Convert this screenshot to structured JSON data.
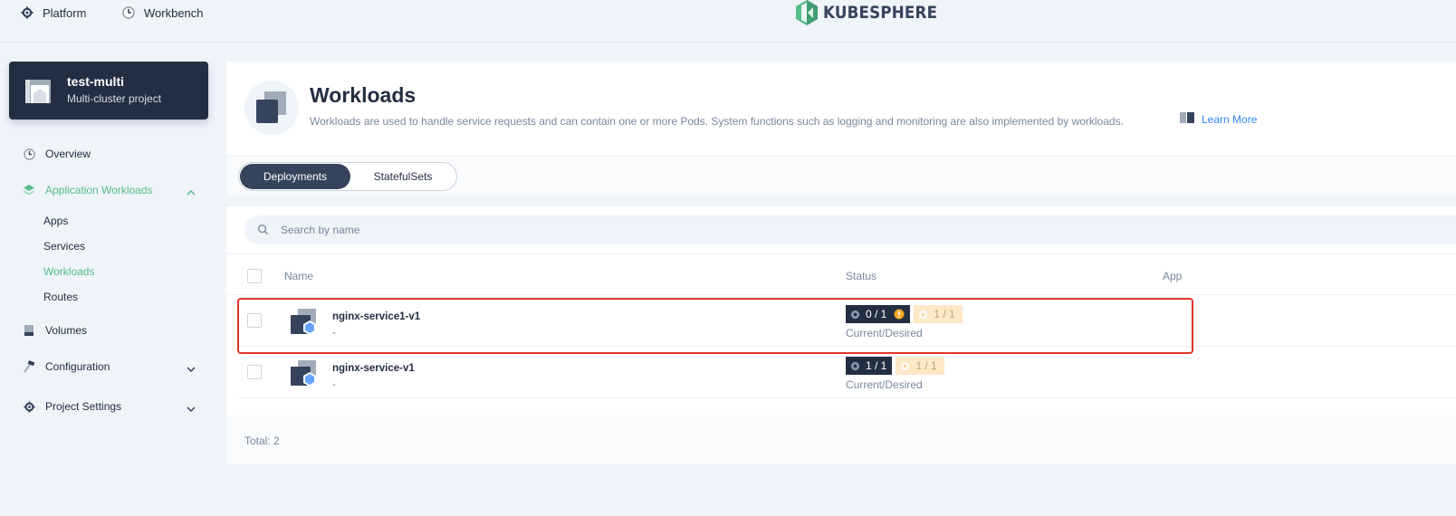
{
  "topbar": {
    "platform_label": "Platform",
    "workbench_label": "Workbench",
    "logo_text": "KUBESPHERE"
  },
  "project": {
    "name": "test-multi",
    "type": "Multi-cluster project"
  },
  "sidebar": {
    "overview": "Overview",
    "app_workloads": "Application Workloads",
    "sub": [
      "Apps",
      "Services",
      "Workloads",
      "Routes"
    ],
    "volumes": "Volumes",
    "configuration": "Configuration",
    "project_settings": "Project Settings"
  },
  "page": {
    "title": "Workloads",
    "description": "Workloads are used to handle service requests and can contain one or more Pods. System functions such as logging and monitoring are also implemented by workloads.",
    "learn_more": "Learn More"
  },
  "tabs": [
    "Deployments",
    "StatefulSets"
  ],
  "search": {
    "placeholder": "Search by name"
  },
  "table": {
    "columns": [
      "Name",
      "Status",
      "App"
    ],
    "rows": [
      {
        "name": "nginx-service1-v1",
        "desc": "-",
        "current": "0 / 1",
        "desired": "1 / 1",
        "status_label": "Current/Desired",
        "warning": true
      },
      {
        "name": "nginx-service-v1",
        "desc": "-",
        "current": "1 / 1",
        "desired": "1 / 1",
        "status_label": "Current/Desired",
        "warning": false
      }
    ],
    "total": "Total: 2"
  },
  "colors": {
    "accent_green": "#55bc8a",
    "dark": "#242e42",
    "highlight_red": "#e0352b",
    "link_blue": "#3385ff"
  }
}
